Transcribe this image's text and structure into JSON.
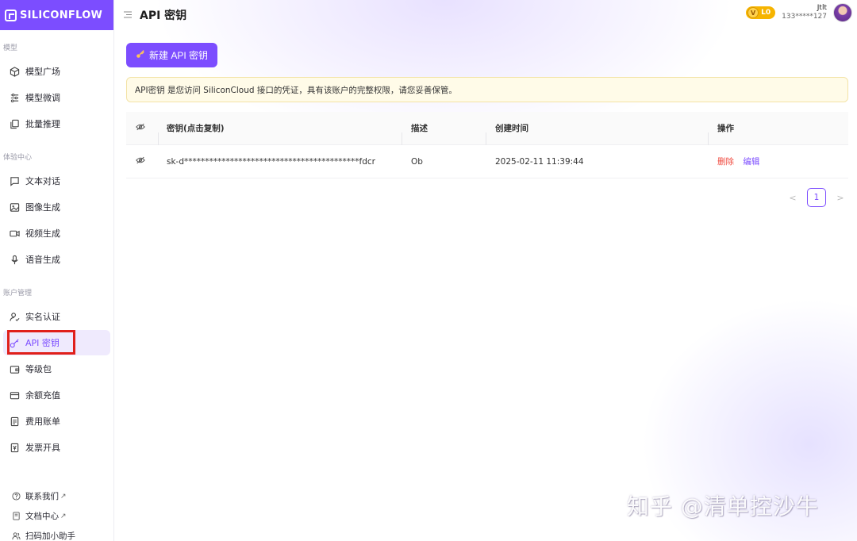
{
  "logo": {
    "text": "SILICONFLOW"
  },
  "sidebar": {
    "groups": [
      {
        "title": "模型",
        "items": [
          {
            "label": "模型广场"
          },
          {
            "label": "模型微调"
          },
          {
            "label": "批量推理"
          }
        ]
      },
      {
        "title": "体验中心",
        "items": [
          {
            "label": "文本对话"
          },
          {
            "label": "图像生成"
          },
          {
            "label": "视频生成"
          },
          {
            "label": "语音生成"
          }
        ]
      },
      {
        "title": "账户管理",
        "items": [
          {
            "label": "实名认证"
          },
          {
            "label": "API 密钥",
            "active": true
          },
          {
            "label": "等级包"
          },
          {
            "label": "余额充值"
          },
          {
            "label": "费用账单"
          },
          {
            "label": "发票开具"
          }
        ]
      }
    ],
    "footer": [
      {
        "label": "联系我们",
        "external": "↗"
      },
      {
        "label": "文档中心",
        "external": "↗"
      },
      {
        "label": "扫码加小助手"
      }
    ]
  },
  "header": {
    "title": "API 密钥",
    "level": {
      "icon_letter": "V",
      "label": "L0"
    },
    "user": {
      "name": "Jtlt",
      "phone": "133*****127"
    }
  },
  "main": {
    "create_button": "新建 API 密钥",
    "notice": "API密钥 是您访问 SiliconCloud 接口的凭证，具有该账户的完整权限，请您妥善保管。",
    "table": {
      "headers": {
        "key": "密钥(点击复制)",
        "desc": "描述",
        "created": "创建时间",
        "actions": "操作"
      },
      "rows": [
        {
          "key": "sk-d******************************************fdcr",
          "desc": "Ob",
          "created": "2025-02-11 11:39:44",
          "delete": "删除",
          "edit": "编辑"
        }
      ]
    },
    "pagination": {
      "current": "1",
      "prev": "<",
      "next": ">"
    }
  },
  "watermark": "知乎 @清单控沙牛",
  "colors": {
    "brand": "#7c4dff",
    "danger": "#f04a3f",
    "level_badge": "#f6b400"
  }
}
